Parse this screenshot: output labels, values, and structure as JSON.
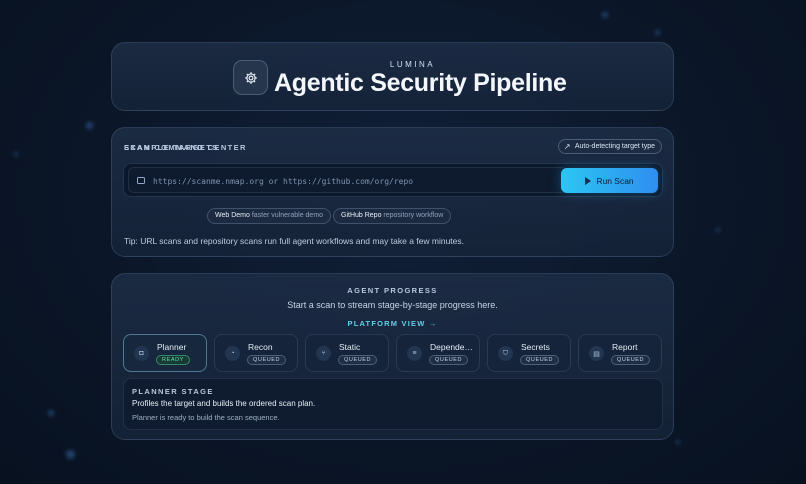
{
  "header": {
    "brand": "LUMINA",
    "title": "Agentic Security Pipeline",
    "logo_icon": "gear-icon"
  },
  "scan": {
    "section_label": "SCAN COMMAND CENTER",
    "auto_detect_label": "Auto-detecting target type",
    "input": {
      "value": "",
      "placeholder": "https://scanme.nmap.org or https://github.com/org/repo"
    },
    "run_button_label": "Run Scan",
    "examples_label": "EXAMPLE TARGETS",
    "examples": [
      {
        "name": "Web Demo",
        "desc": "faster vulnerable demo"
      },
      {
        "name": "GitHub Repo",
        "desc": "repository workflow"
      }
    ],
    "tip": "Tip: URL scans and repository scans run full agent workflows and may take a few minutes."
  },
  "progress": {
    "section_label": "AGENT PROGRESS",
    "subtitle": "Start a scan to stream stage-by-stage progress here.",
    "platform_link": "PLATFORM VIEW →",
    "stages": [
      {
        "name": "Planner",
        "status": "READY",
        "icon": "robot-icon"
      },
      {
        "name": "Recon",
        "status": "QUEUED",
        "icon": "radar-icon"
      },
      {
        "name": "Static",
        "status": "QUEUED",
        "icon": "code-branch-icon"
      },
      {
        "name": "Dependen…",
        "status": "QUEUED",
        "icon": "database-icon"
      },
      {
        "name": "Secrets",
        "status": "QUEUED",
        "icon": "shield-icon"
      },
      {
        "name": "Report",
        "status": "QUEUED",
        "icon": "document-icon"
      }
    ],
    "detail": {
      "label": "PLANNER STAGE",
      "description": "Profiles the target and builds the ordered scan plan.",
      "status": "Planner is ready to build the scan sequence."
    }
  },
  "colors": {
    "accent": "#2cc6f2",
    "ready": "#5fe0a8",
    "background": "#0b1628"
  }
}
